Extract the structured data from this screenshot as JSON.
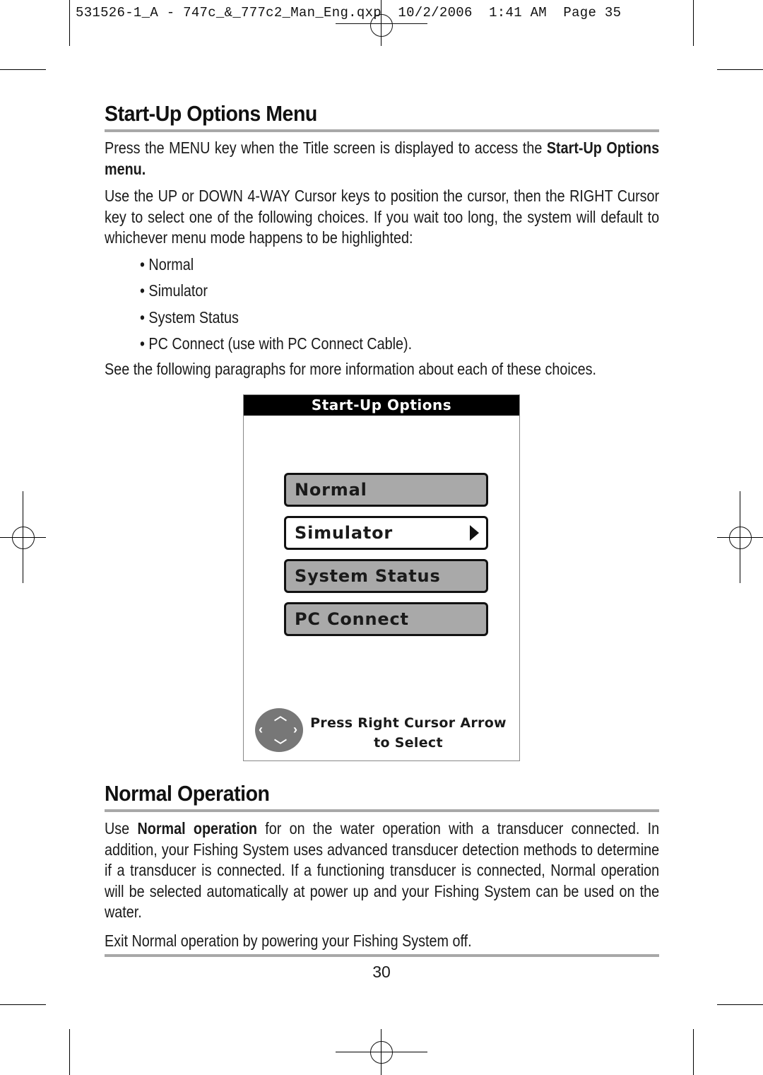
{
  "slug": {
    "text": "531526-1_A - 747c_&_777c2_Man_Eng.qxp  10/2/2006  1:41 AM  Page 35"
  },
  "section1": {
    "title": "Start-Up Options Menu",
    "para1_pre": "Press the MENU key when the Title screen is displayed to access the ",
    "para1_bold": "Start-Up Options menu.",
    "para2": "Use the UP or  DOWN 4-WAY Cursor keys to position the cursor, then the RIGHT Cursor key to select one of the following choices. If you wait too long, the system will default to whichever menu mode happens to be highlighted:",
    "bullets": [
      "• Normal",
      "• Simulator",
      "• System Status",
      "• PC Connect (use with PC Connect Cable)."
    ],
    "para3": "See the following paragraphs for more information about each of these choices."
  },
  "screen": {
    "title": "Start-Up Options",
    "options": [
      {
        "label": "Normal",
        "selected": false
      },
      {
        "label": "Simulator",
        "selected": true
      },
      {
        "label": "System Status",
        "selected": false
      },
      {
        "label": "PC Connect",
        "selected": false
      }
    ],
    "hint_line1": "Press Right Cursor Arrow",
    "hint_line2": "to  Select",
    "dpad_icon": "four-way-cursor-pad-icon"
  },
  "section2": {
    "title": "Normal Operation",
    "para1_pre": "Use ",
    "para1_bold": "Normal operation",
    "para1_post": " for on the water operation with a transducer connected. In addition, your Fishing System uses advanced transducer detection methods to determine if a transducer is connected. If a functioning transducer is connected, Normal operation will be selected automatically at power up and your Fishing System can be used on the water.",
    "para2": "Exit Normal operation by powering your Fishing System off."
  },
  "page_number": "30"
}
